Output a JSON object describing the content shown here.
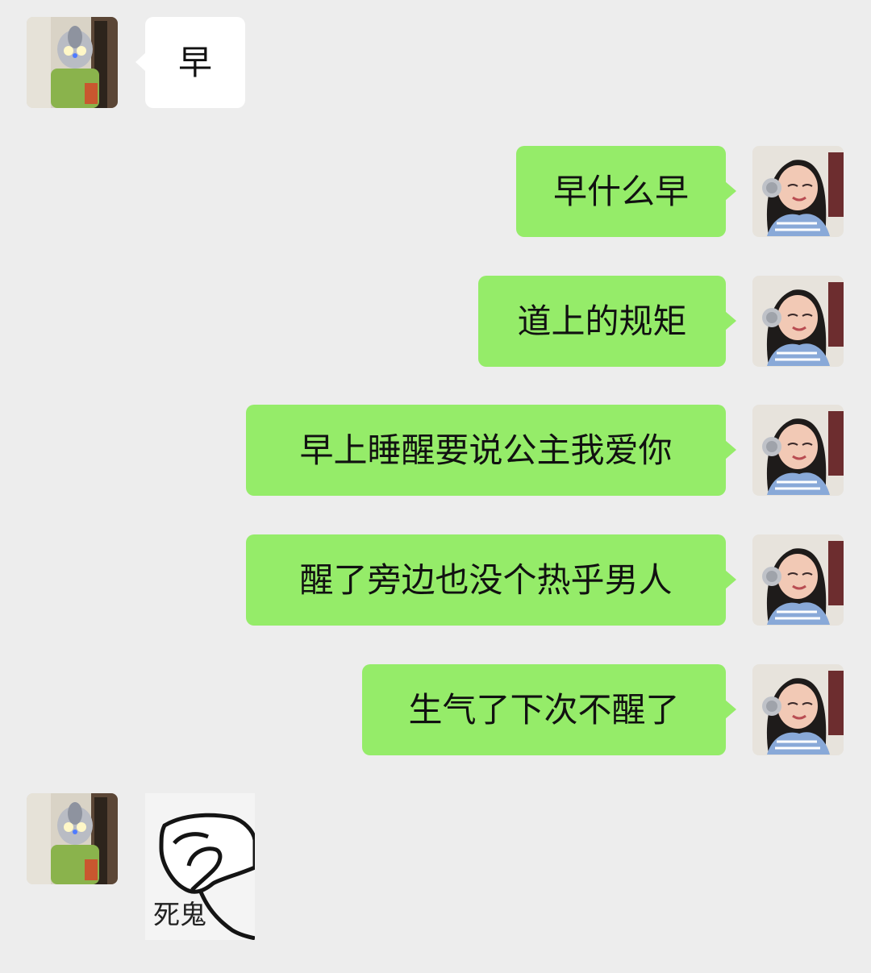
{
  "chat": {
    "messages": [
      {
        "sender": "contact",
        "avatar": "contact-avatar",
        "text": "早"
      },
      {
        "sender": "me",
        "avatar": "self-avatar",
        "text": "早什么早"
      },
      {
        "sender": "me",
        "avatar": "self-avatar",
        "text": "道上的规矩"
      },
      {
        "sender": "me",
        "avatar": "self-avatar",
        "text": "早上睡醒要说公主我爱你"
      },
      {
        "sender": "me",
        "avatar": "self-avatar",
        "text": "醒了旁边也没个热乎男人"
      },
      {
        "sender": "me",
        "avatar": "self-avatar",
        "text": "生气了下次不醒了"
      },
      {
        "sender": "contact",
        "avatar": "contact-avatar",
        "type": "sticker",
        "caption": "死鬼"
      }
    ]
  },
  "colors": {
    "background": "#ededed",
    "incoming_bubble": "#ffffff",
    "outgoing_bubble": "#95ec69"
  }
}
